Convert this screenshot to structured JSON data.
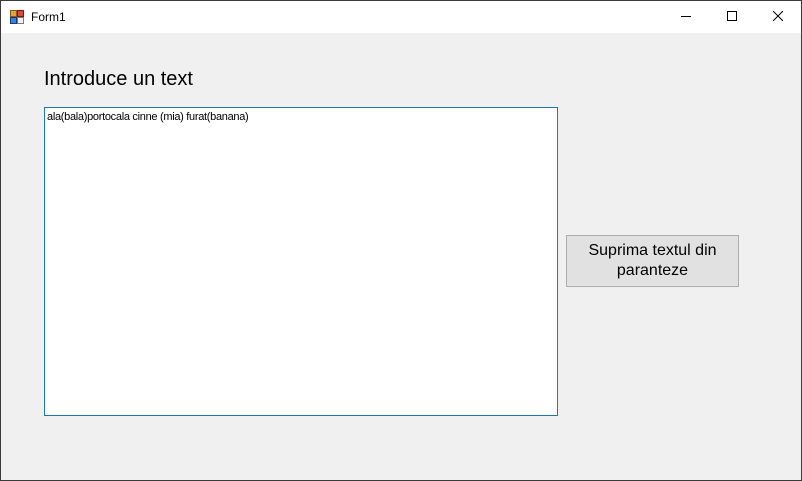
{
  "window": {
    "title": "Form1",
    "icon": "winforms-app-icon",
    "controls": {
      "minimize_icon": "minimize-icon",
      "maximize_icon": "maximize-icon",
      "close_icon": "close-icon"
    }
  },
  "form": {
    "heading": "Introduce un text",
    "textbox_value": "ala(bala)portocala cinne (mia) furat(banana)",
    "button_label": "Suprima textul din paranteze"
  },
  "colors": {
    "textbox_border": "#1e78b4",
    "button_background": "#e1e1e1",
    "button_border": "#adadad",
    "client_background": "#f0f0f0"
  }
}
